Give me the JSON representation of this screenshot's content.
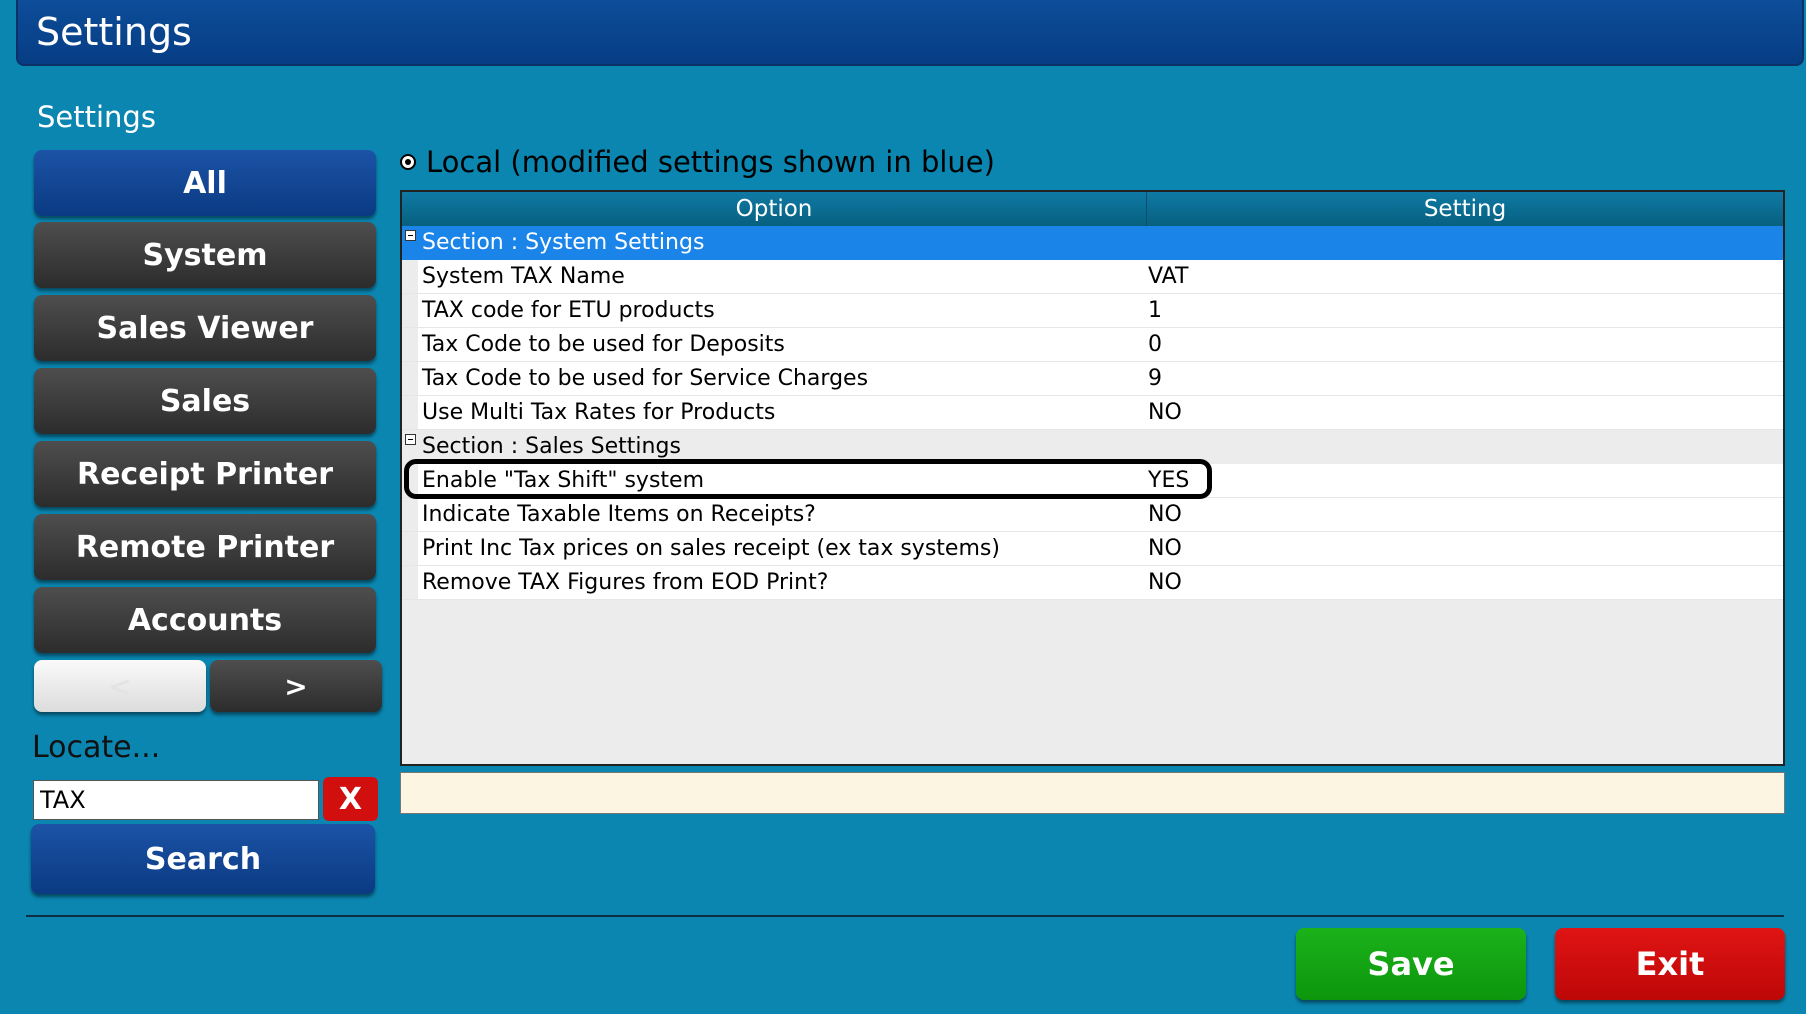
{
  "window": {
    "title": "Settings"
  },
  "sidebar": {
    "heading": "Settings",
    "categories": [
      {
        "label": "All",
        "active": true
      },
      {
        "label": "System"
      },
      {
        "label": "Sales Viewer"
      },
      {
        "label": "Sales"
      },
      {
        "label": "Receipt Printer"
      },
      {
        "label": "Remote Printer"
      },
      {
        "label": "Accounts"
      }
    ],
    "pager": {
      "prev_label": "<",
      "next_label": ">"
    },
    "locate": {
      "label": "Locate...",
      "value": "TAX",
      "clear_label": "X"
    },
    "search_label": "Search"
  },
  "main": {
    "radio_label": "Local (modified settings shown in blue)",
    "grid": {
      "columns": [
        "Option",
        "Setting"
      ],
      "sections": [
        {
          "title": "Section : System Settings",
          "selected": true,
          "rows": [
            {
              "option": "System TAX Name",
              "setting": "VAT"
            },
            {
              "option": "TAX code for ETU products",
              "setting": "1"
            },
            {
              "option": "Tax Code to be used for Deposits",
              "setting": "0"
            },
            {
              "option": "Tax Code to be used for Service Charges",
              "setting": "9"
            },
            {
              "option": "Use Multi Tax Rates for Products",
              "setting": "NO"
            }
          ]
        },
        {
          "title": "Section : Sales Settings",
          "selected": false,
          "rows": [
            {
              "option": "Enable \"Tax Shift\" system",
              "setting": "YES",
              "highlighted": true
            },
            {
              "option": "Indicate Taxable Items on Receipts?",
              "setting": "NO"
            },
            {
              "option": "Print Inc Tax prices on sales receipt (ex tax systems)",
              "setting": "NO"
            },
            {
              "option": "Remove TAX Figures from EOD Print?",
              "setting": "NO"
            }
          ]
        }
      ]
    },
    "description": ""
  },
  "footer": {
    "save_label": "Save",
    "exit_label": "Exit"
  },
  "colors": {
    "background": "#0a86b0",
    "title_bar": "#063d84",
    "selected_section": "#1a84e8",
    "save": "#0c960c",
    "exit": "#bd0707",
    "description_bg": "#fcf5e2"
  }
}
